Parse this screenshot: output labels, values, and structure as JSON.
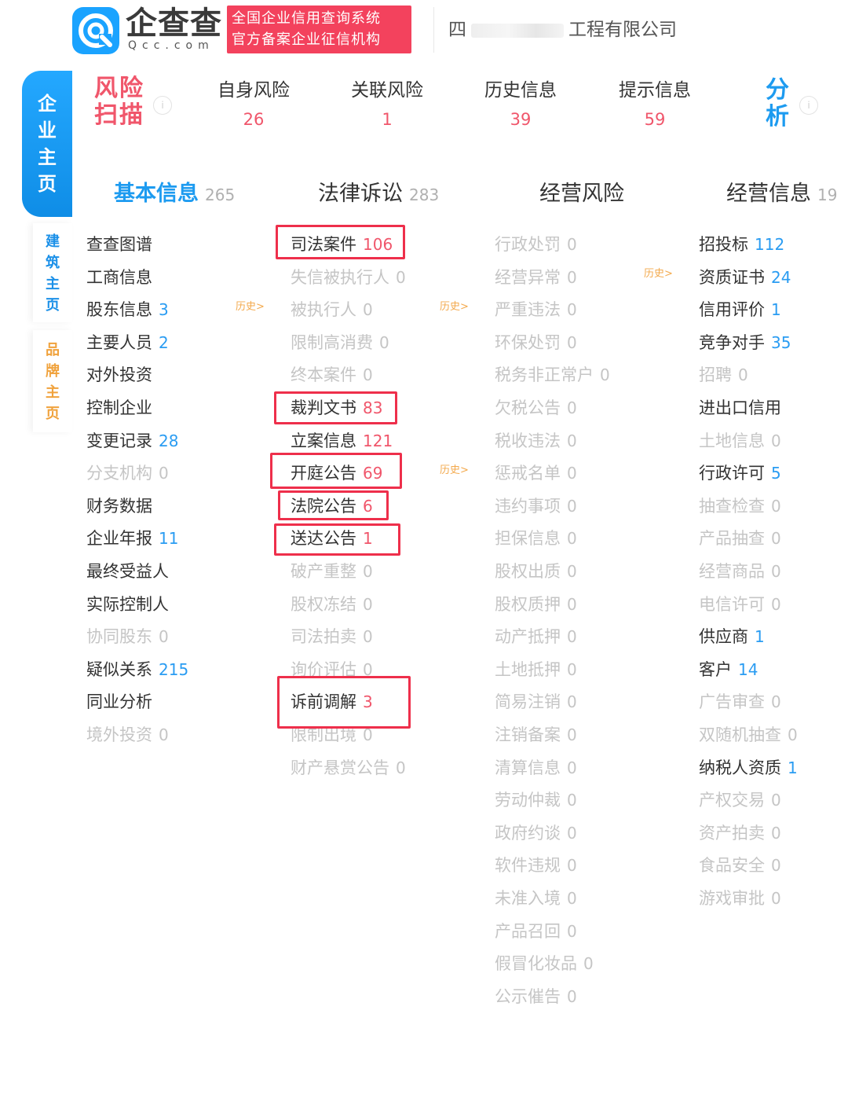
{
  "header": {
    "logo_text": "企查查",
    "logo_sub": "Qcc.com",
    "slogan_line1": "全国企业信用查询系统",
    "slogan_line2": "官方备案企业征信机构",
    "company_prefix": "四",
    "company_suffix": "工程有限公司"
  },
  "side_tabs": {
    "main": [
      "企",
      "业",
      "主",
      "页"
    ],
    "build": [
      "建",
      "筑",
      "主",
      "页"
    ],
    "brand": [
      "品",
      "牌",
      "主",
      "页"
    ]
  },
  "risk_scan": {
    "title_line1": "风险",
    "title_line2": "扫描",
    "info_icon": "i",
    "items": [
      {
        "label": "自身风险",
        "count": "26"
      },
      {
        "label": "关联风险",
        "count": "1"
      },
      {
        "label": "历史信息",
        "count": "39"
      },
      {
        "label": "提示信息",
        "count": "59"
      }
    ],
    "analysis_line1": "分",
    "analysis_line2": "析"
  },
  "categories": [
    {
      "label": "基本信息",
      "count": "265"
    },
    {
      "label": "法律诉讼",
      "count": "283"
    },
    {
      "label": "经营风险",
      "count": ""
    },
    {
      "label": "经营信息",
      "count": "19"
    }
  ],
  "history_label": "历史>",
  "columns": {
    "basic": [
      {
        "label": "查查图谱",
        "count": ""
      },
      {
        "label": "工商信息",
        "count": ""
      },
      {
        "label": "股东信息",
        "count": "3"
      },
      {
        "label": "主要人员",
        "count": "2"
      },
      {
        "label": "对外投资",
        "count": ""
      },
      {
        "label": "控制企业",
        "count": ""
      },
      {
        "label": "变更记录",
        "count": "28"
      },
      {
        "label": "分支机构",
        "count": "0"
      },
      {
        "label": "财务数据",
        "count": ""
      },
      {
        "label": "企业年报",
        "count": "11"
      },
      {
        "label": "最终受益人",
        "count": ""
      },
      {
        "label": "实际控制人",
        "count": ""
      },
      {
        "label": "协同股东",
        "count": "0"
      },
      {
        "label": "疑似关系",
        "count": "215"
      },
      {
        "label": "同业分析",
        "count": ""
      },
      {
        "label": "境外投资",
        "count": "0"
      }
    ],
    "law": [
      {
        "label": "司法案件",
        "count": "106"
      },
      {
        "label": "失信被执行人",
        "count": "0"
      },
      {
        "label": "被执行人",
        "count": "0"
      },
      {
        "label": "限制高消费",
        "count": "0"
      },
      {
        "label": "终本案件",
        "count": "0"
      },
      {
        "label": "裁判文书",
        "count": "83"
      },
      {
        "label": "立案信息",
        "count": "121"
      },
      {
        "label": "开庭公告",
        "count": "69"
      },
      {
        "label": "法院公告",
        "count": "6"
      },
      {
        "label": "送达公告",
        "count": "1"
      },
      {
        "label": "破产重整",
        "count": "0"
      },
      {
        "label": "股权冻结",
        "count": "0"
      },
      {
        "label": "司法拍卖",
        "count": "0"
      },
      {
        "label": "询价评估",
        "count": "0"
      },
      {
        "label": "诉前调解",
        "count": "3"
      },
      {
        "label": "限制出境",
        "count": "0"
      },
      {
        "label": "财产悬赏公告",
        "count": "0"
      }
    ],
    "risk": [
      {
        "label": "行政处罚",
        "count": "0"
      },
      {
        "label": "经营异常",
        "count": "0"
      },
      {
        "label": "严重违法",
        "count": "0"
      },
      {
        "label": "环保处罚",
        "count": "0"
      },
      {
        "label": "税务非正常户",
        "count": "0"
      },
      {
        "label": "欠税公告",
        "count": "0"
      },
      {
        "label": "税收违法",
        "count": "0"
      },
      {
        "label": "惩戒名单",
        "count": "0"
      },
      {
        "label": "违约事项",
        "count": "0"
      },
      {
        "label": "担保信息",
        "count": "0"
      },
      {
        "label": "股权出质",
        "count": "0"
      },
      {
        "label": "股权质押",
        "count": "0"
      },
      {
        "label": "动产抵押",
        "count": "0"
      },
      {
        "label": "土地抵押",
        "count": "0"
      },
      {
        "label": "简易注销",
        "count": "0"
      },
      {
        "label": "注销备案",
        "count": "0"
      },
      {
        "label": "清算信息",
        "count": "0"
      },
      {
        "label": "劳动仲裁",
        "count": "0"
      },
      {
        "label": "政府约谈",
        "count": "0"
      },
      {
        "label": "软件违规",
        "count": "0"
      },
      {
        "label": "未准入境",
        "count": "0"
      },
      {
        "label": "产品召回",
        "count": "0"
      },
      {
        "label": "假冒化妆品",
        "count": "0"
      },
      {
        "label": "公示催告",
        "count": "0"
      }
    ],
    "biz": [
      {
        "label": "招投标",
        "count": "112"
      },
      {
        "label": "资质证书",
        "count": "24"
      },
      {
        "label": "信用评价",
        "count": "1"
      },
      {
        "label": "竞争对手",
        "count": "35"
      },
      {
        "label": "招聘",
        "count": "0"
      },
      {
        "label": "进出口信用",
        "count": ""
      },
      {
        "label": "土地信息",
        "count": "0"
      },
      {
        "label": "行政许可",
        "count": "5"
      },
      {
        "label": "抽查检查",
        "count": "0"
      },
      {
        "label": "产品抽查",
        "count": "0"
      },
      {
        "label": "经营商品",
        "count": "0"
      },
      {
        "label": "电信许可",
        "count": "0"
      },
      {
        "label": "供应商",
        "count": "1"
      },
      {
        "label": "客户",
        "count": "14"
      },
      {
        "label": "广告审查",
        "count": "0"
      },
      {
        "label": "双随机抽查",
        "count": "0"
      },
      {
        "label": "纳税人资质",
        "count": "1"
      },
      {
        "label": "产权交易",
        "count": "0"
      },
      {
        "label": "资产拍卖",
        "count": "0"
      },
      {
        "label": "食品安全",
        "count": "0"
      },
      {
        "label": "游戏审批",
        "count": "0"
      }
    ]
  },
  "colors": {
    "brand_blue": "#1aa3ff",
    "risk_red": "#f0566b",
    "highlight_red": "#ee2f4b",
    "link_blue": "#2a9cf2",
    "history_orange": "#f3a94c",
    "disabled_gray": "#c5c5c5"
  }
}
